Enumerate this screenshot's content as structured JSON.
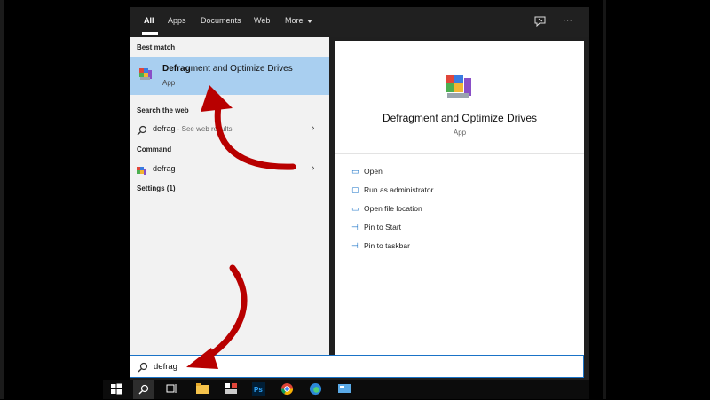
{
  "tabs": [
    {
      "label": "All"
    },
    {
      "label": "Apps"
    },
    {
      "label": "Documents"
    },
    {
      "label": "Web"
    },
    {
      "label": "More"
    }
  ],
  "icons": {
    "feedback": "feedback-icon",
    "more": "ellipsis-icon",
    "search": "search-icon"
  },
  "sections": {
    "best_match": "Best match",
    "search_web": "Search the web",
    "command": "Command",
    "settings": "Settings (1)"
  },
  "best_match": {
    "title_bold": "Defrag",
    "title_rest": "ment and Optimize Drives",
    "subtitle": "App"
  },
  "web_result": {
    "query": "defrag",
    "suffix": " - See web results"
  },
  "command_result": {
    "label": "defrag"
  },
  "preview": {
    "title": "Defragment and Optimize Drives",
    "subtitle": "App",
    "actions": [
      {
        "label": "Open"
      },
      {
        "label": "Run as administrator"
      },
      {
        "label": "Open file location"
      },
      {
        "label": "Pin to Start"
      },
      {
        "label": "Pin to taskbar"
      }
    ]
  },
  "search": {
    "value": "defrag"
  },
  "taskbar": {
    "items": [
      "windows-start",
      "search",
      "task-view",
      "file-explorer",
      "app",
      "photoshop",
      "chrome",
      "edge",
      "app-window"
    ],
    "colors": {
      "start": "#ffffff",
      "explorer": "#f5c34b",
      "photoshop": "#31a8ff",
      "chrome": "#db4437",
      "edge": "#2b88d8"
    }
  },
  "colors": {
    "accent": "#1a73c7",
    "highlight": "#a9cff0",
    "arrow": "#b80000"
  }
}
